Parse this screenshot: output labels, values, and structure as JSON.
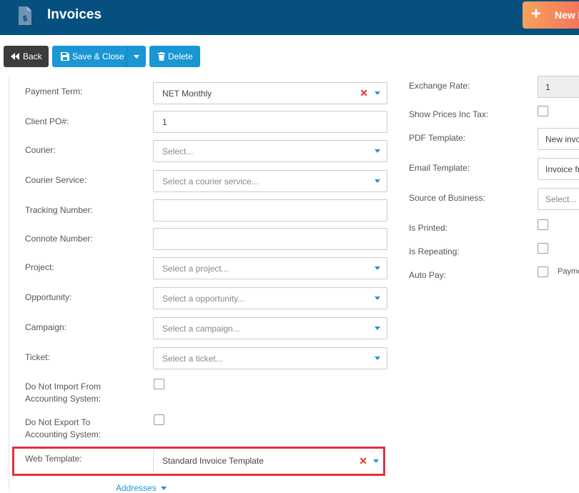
{
  "header": {
    "title": "Invoices",
    "new_button_label": "New I"
  },
  "toolbar": {
    "back_label": "Back",
    "save_close_label": "Save & Close",
    "delete_label": "Delete"
  },
  "left_form": {
    "payment_term": {
      "label": "Payment Term:",
      "value": "NET Monthly"
    },
    "client_po": {
      "label": "Client PO#:",
      "value": "1"
    },
    "courier": {
      "label": "Courier:",
      "placeholder": "Select..."
    },
    "courier_service": {
      "label": "Courier Service:",
      "placeholder": "Select a courier service..."
    },
    "tracking_number": {
      "label": "Tracking Number:",
      "value": ""
    },
    "connote_number": {
      "label": "Connote Number:",
      "value": ""
    },
    "project": {
      "label": "Project:",
      "placeholder": "Select a project..."
    },
    "opportunity": {
      "label": "Opportunity:",
      "placeholder": "Select a opportunity..."
    },
    "campaign": {
      "label": "Campaign:",
      "placeholder": "Select a campaign..."
    },
    "ticket": {
      "label": "Ticket:",
      "placeholder": "Select a ticket..."
    },
    "do_not_import": {
      "label_line1": "Do Not Import From",
      "label_line2": "Accounting System:"
    },
    "do_not_export": {
      "label_line1": "Do Not Export To",
      "label_line2": "Accounting System:"
    },
    "web_template": {
      "label": "Web Template:",
      "value": "Standard Invoice Template"
    },
    "addresses_label": "Addresses"
  },
  "right_form": {
    "exchange_rate": {
      "label": "Exchange Rate:",
      "value": "1"
    },
    "show_prices_inc_tax": {
      "label": "Show Prices Inc Tax:"
    },
    "pdf_template": {
      "label": "PDF Template:",
      "value": "New invo"
    },
    "email_template": {
      "label": "Email Template:",
      "value": "Invoice fr"
    },
    "source_of_business": {
      "label": "Source of Business:",
      "placeholder": "Select..."
    },
    "is_printed": {
      "label": "Is Printed:"
    },
    "is_repeating": {
      "label": "Is Repeating:"
    },
    "auto_pay": {
      "label": "Auto Pay:",
      "option_label": "Payme"
    }
  },
  "colors": {
    "header_bg": "#05507f",
    "primary_button": "#1a96d4",
    "back_button": "#3c3c3c",
    "highlight_border": "#e0323c",
    "clear_icon": "#e0362c"
  }
}
